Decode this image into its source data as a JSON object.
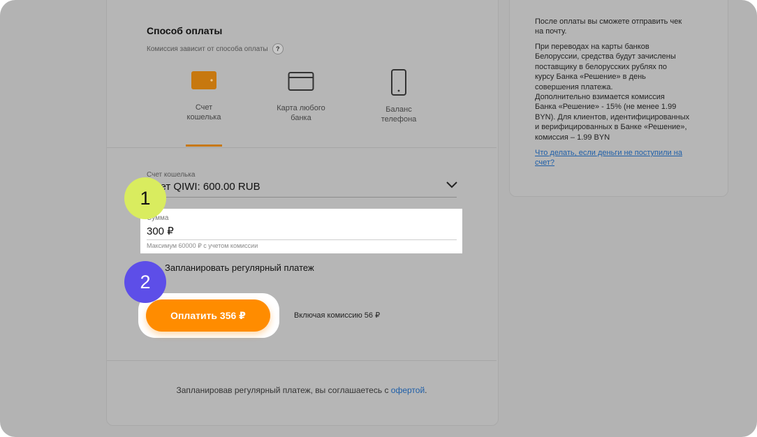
{
  "payment": {
    "title": "Способ оплаты",
    "subtitle": "Комиссия зависит от способа оплаты",
    "help": "?",
    "methods": [
      {
        "line1": "Счет",
        "line2": "кошелька",
        "icon": "wallet-icon",
        "selected": true
      },
      {
        "line1": "Карта любого",
        "line2": "банка",
        "icon": "card-icon",
        "selected": false
      },
      {
        "line1": "Баланс",
        "line2": "телефона",
        "icon": "phone-icon",
        "selected": false
      }
    ]
  },
  "wallet": {
    "label": "Счет кошелька",
    "value": "Счет QIWI: 600.00 RUB"
  },
  "amount": {
    "label": "Сумма",
    "value": "300 ₽",
    "hint": "Максимум 60000 ₽ с учетом комиссии"
  },
  "recurring_label": "Запланировать регулярный платеж",
  "pay_button": "Оплатить 356 ₽",
  "commission_text": "Включая комиссию 56 ₽",
  "agreement": {
    "text": "Запланировав регулярный платеж, вы соглашаетесь с ",
    "link": "офертой",
    "end": "."
  },
  "side": {
    "para1_lines": [
      "После оплаты вы сможете отправить чек",
      "на почту."
    ],
    "para2_lines": [
      "При переводах на карты банков",
      "Белоруссии, средства будут зачислены",
      "поставщику в белорусских рублях по",
      "курсу Банка «Решение» в день",
      "совершения платежа.",
      "Дополнительно взимается комиссия",
      "Банка «Решение» - 15% (не менее 1.99",
      "BYN). Для клиентов, идентифицированных",
      "и верифицированных в Банке «Решение»,",
      "комиссия – 1.99 BYN"
    ],
    "link_lines": [
      "Что делать, если деньги не поступили на",
      "счет?"
    ]
  },
  "badges": {
    "one": "1",
    "two": "2"
  },
  "colors": {
    "accent": "#ff8c00",
    "wallet": "#c7780f",
    "badge1": "#d9ec5f",
    "badge2": "#5d4ee8",
    "link": "#1f5fa8"
  }
}
